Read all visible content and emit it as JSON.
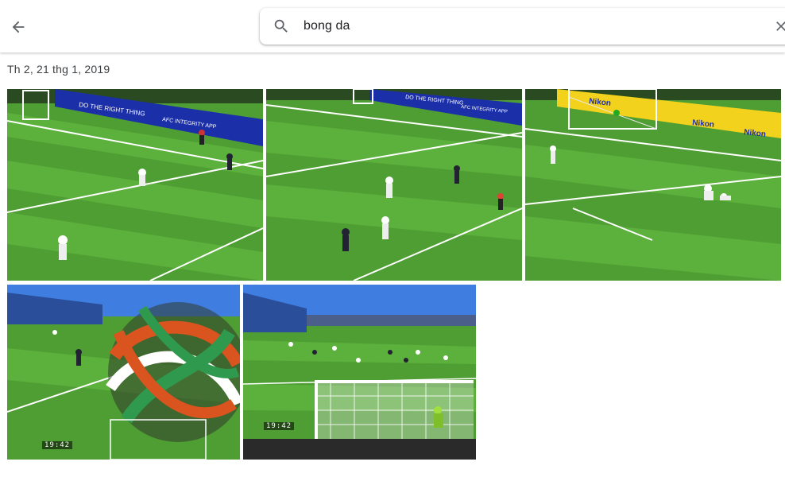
{
  "header": {
    "back_icon": "arrow-back-icon",
    "search": {
      "icon": "search-icon",
      "query": "bong da",
      "clear_icon": "close-icon"
    }
  },
  "results": {
    "date_label": "Th 2, 21 thg 1, 2019",
    "photos": [
      {
        "id": 1,
        "board_text": "DO THE RIGHT THING"
      },
      {
        "id": 2,
        "board_text": "DO THE RIGHT THING"
      },
      {
        "id": 3,
        "board_text": "Nikon"
      },
      {
        "id": 4,
        "timestamp": "19:42"
      },
      {
        "id": 5,
        "timestamp": "19:42"
      }
    ],
    "board_texts": {
      "afc_integrity": "AFC INTEGRITY APP",
      "do_the_right_thing": "DO THE RIGHT THING",
      "nikon": "Nikon"
    }
  },
  "colors": {
    "pitch_light": "#5fae3a",
    "pitch_dark": "#3f8f2a",
    "board_blue": "#1b2fa8",
    "board_yellow": "#f2d21c",
    "sky": "#3f7ee0"
  }
}
